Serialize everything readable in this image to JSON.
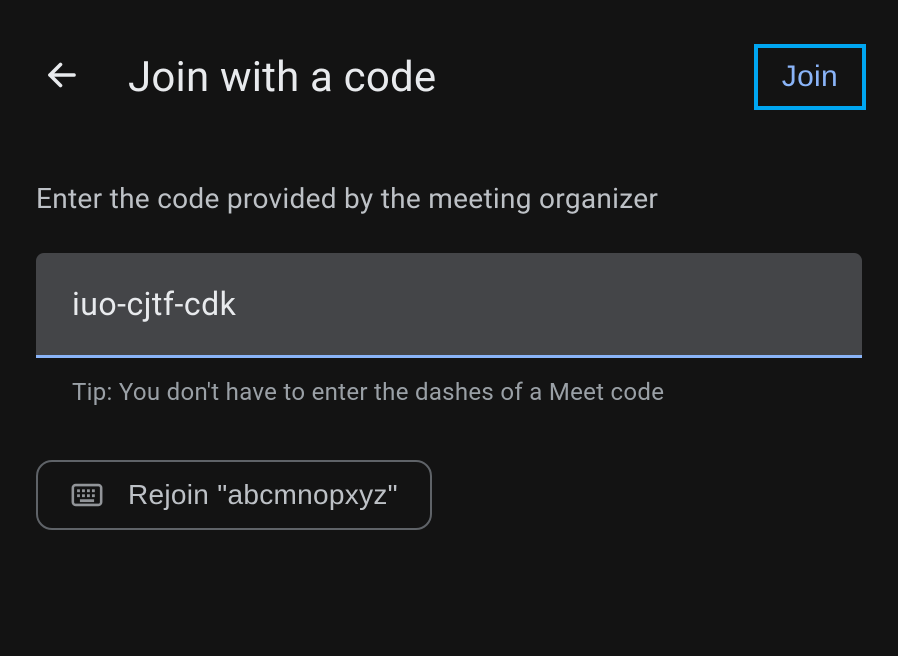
{
  "header": {
    "title": "Join with a code",
    "join_label": "Join"
  },
  "main": {
    "instruction": "Enter the code provided by the meeting organizer",
    "code_value": "iuo-cjtf-cdk",
    "tip": "Tip: You don't have to enter the dashes of a Meet code",
    "rejoin_label": "Rejoin \"abcmnopxyz\""
  },
  "icons": {
    "back": "back-arrow-icon",
    "keyboard": "keyboard-icon"
  }
}
